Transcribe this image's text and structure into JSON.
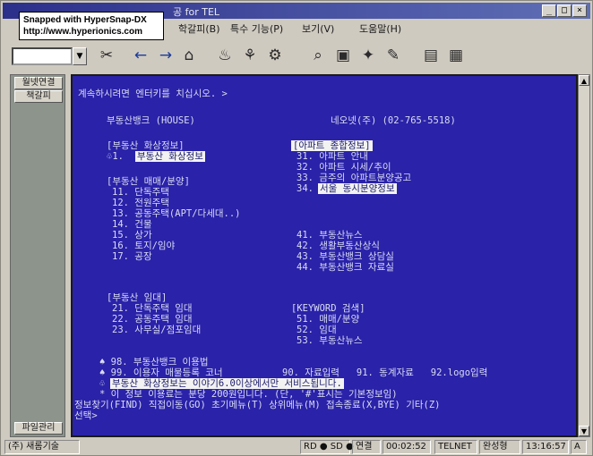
{
  "window": {
    "title": "공 for TEL",
    "controls": [
      "_",
      "□",
      "×"
    ]
  },
  "watermark": {
    "line1": "Snapped with HyperSnap-DX",
    "line2": "http://www.hyperionics.com"
  },
  "menu": [
    "학갈피(B)",
    "특수 기능(P)",
    "보기(V)",
    "도움말(H)"
  ],
  "toolbar": {
    "combo_value": "",
    "icons": [
      "connect-icon",
      "back-arrow-icon",
      "forward-arrow-icon",
      "home-icon",
      "receive-icon",
      "send-icon",
      "transfer-icon",
      "search-icon",
      "capture-icon",
      "settings-icon",
      "edit-icon",
      "window-icon",
      "layout-icon"
    ]
  },
  "sidebar": {
    "top_buttons": [
      "월넷연결",
      "책갈피"
    ],
    "bottom_button": "파일관리"
  },
  "terminal": {
    "lines": [
      {
        "id": "prompt",
        "text": "계속하시려면 엔터키를 치십시오. >"
      },
      {
        "id": "brand-left",
        "text": "부동산뱅크 (HOUSE)"
      },
      {
        "id": "brand-right",
        "text": "네오넷(주) (02-765-5518)"
      },
      {
        "id": "sec1-head",
        "text": "[부동산 화상정보]"
      },
      {
        "id": "sec1-item1",
        "text": "♧1. "
      },
      {
        "id": "sec1-item1-hl",
        "text": "부동산 화상정보"
      },
      {
        "id": "apt-head",
        "text": "[아파트 종합정보]"
      },
      {
        "id": "apt-31",
        "text": "31. 아파트 안내"
      },
      {
        "id": "apt-32",
        "text": "32. 아파트 시세/추이"
      },
      {
        "id": "apt-33",
        "text": "33. 금주의 아파트분양공고"
      },
      {
        "id": "apt-34",
        "text": "34. "
      },
      {
        "id": "apt-34-hl",
        "text": "서울 동시분양정보"
      },
      {
        "id": "sec2-head",
        "text": "[부동산 매매/분양]"
      },
      {
        "id": "s11",
        "text": "11. 단독주택"
      },
      {
        "id": "s12",
        "text": "12. 전원주택"
      },
      {
        "id": "s13",
        "text": "13. 공동주택(APT/다세대..)"
      },
      {
        "id": "s14",
        "text": "14. 건물"
      },
      {
        "id": "s15",
        "text": "15. 상가"
      },
      {
        "id": "s16",
        "text": "16. 토지/임야"
      },
      {
        "id": "s17",
        "text": "17. 공장"
      },
      {
        "id": "s41",
        "text": "41. 부동산뉴스"
      },
      {
        "id": "s42",
        "text": "42. 생활부동산상식"
      },
      {
        "id": "s43",
        "text": "43. 부동산뱅크 상담실"
      },
      {
        "id": "s44",
        "text": "44. 부동산뱅크 자료실"
      },
      {
        "id": "sec3-head",
        "text": "[부동산 임대]"
      },
      {
        "id": "s21",
        "text": "21. 단독주택 임대"
      },
      {
        "id": "s22",
        "text": "22. 공동주택 임대"
      },
      {
        "id": "s23",
        "text": "23. 사무실/점포임대"
      },
      {
        "id": "kw-head",
        "text": "[KEYWORD 검색]"
      },
      {
        "id": "s51",
        "text": "51. 매매/분양"
      },
      {
        "id": "s52",
        "text": "52. 임대"
      },
      {
        "id": "s53",
        "text": "53. 부동산뉴스"
      },
      {
        "id": "s98",
        "text": "♠ 98. 부동산뱅크 이용법"
      },
      {
        "id": "s99",
        "text": "♠ 99. 이용자 매물등록 코너"
      },
      {
        "id": "s90",
        "text": "90. 자료입력   91. 동계자료   92.logo입력"
      },
      {
        "id": "notice-prefix",
        "text": "♧"
      },
      {
        "id": "notice-hl",
        "text": "부동산 화상정보는 이야기6.0이상에서만 서비스됩니다."
      },
      {
        "id": "notice2",
        "text": "* 이 정보 이용료는 분당 200원입니다. (단, '#'표시는 기본정보임)"
      },
      {
        "id": "nav",
        "text": "정보찾기(FIND) 직접이동(GO) 초기메뉴(T) 상위메뉴(M) 접속종료(X,BYE) 기타(Z)"
      },
      {
        "id": "select",
        "text": "선택>"
      }
    ]
  },
  "status": {
    "company": "(주) 새롬기술",
    "rd": "RD ● SD ●",
    "conn": "연결",
    "time": "00:02:52",
    "proto": "TELNET",
    "mode": "완성형",
    "clock": "13:16:57",
    "ime": "A"
  }
}
